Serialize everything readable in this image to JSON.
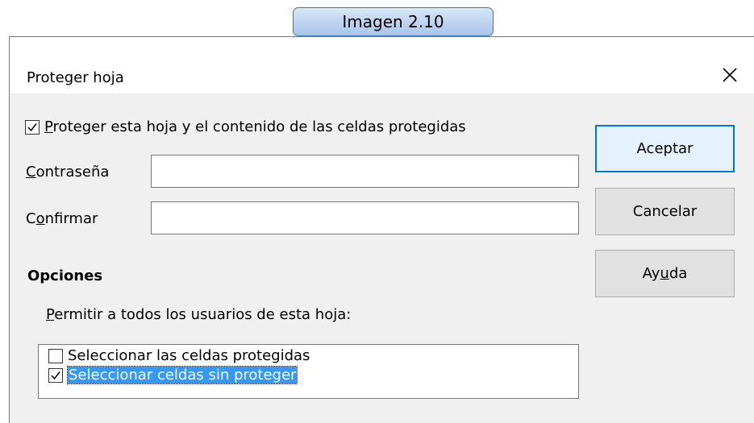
{
  "caption": "Imagen 2.10",
  "dialog": {
    "title": "Proteger hoja",
    "protect_checkbox": {
      "checked": true,
      "label_mnemonic": "P",
      "label_rest": "roteger esta hoja y el contenido de las celdas protegidas"
    },
    "password": {
      "label_mnemonic": "C",
      "label_rest": "ontraseña",
      "value": ""
    },
    "confirm": {
      "label_start": "C",
      "label_mnemonic": "o",
      "label_rest": "nfirmar",
      "value": ""
    },
    "options_heading": "Opciones",
    "allow_label_mnemonic": "P",
    "allow_label_rest": "ermitir a todos los usuarios de esta hoja:",
    "options": [
      {
        "label": "Seleccionar las celdas protegidas",
        "checked": false,
        "selected": false
      },
      {
        "label": "Seleccionar celdas sin proteger",
        "checked": true,
        "selected": true
      }
    ],
    "buttons": {
      "ok": "Aceptar",
      "cancel": "Cancelar",
      "help_start": "Ay",
      "help_mnemonic": "u",
      "help_rest": "da"
    }
  },
  "colors": {
    "accent": "#0078d7",
    "selection": "#3399ff",
    "dialog_bg": "#f0f0f0"
  },
  "icons": {
    "close": "close-icon",
    "check": "checkmark-icon"
  }
}
